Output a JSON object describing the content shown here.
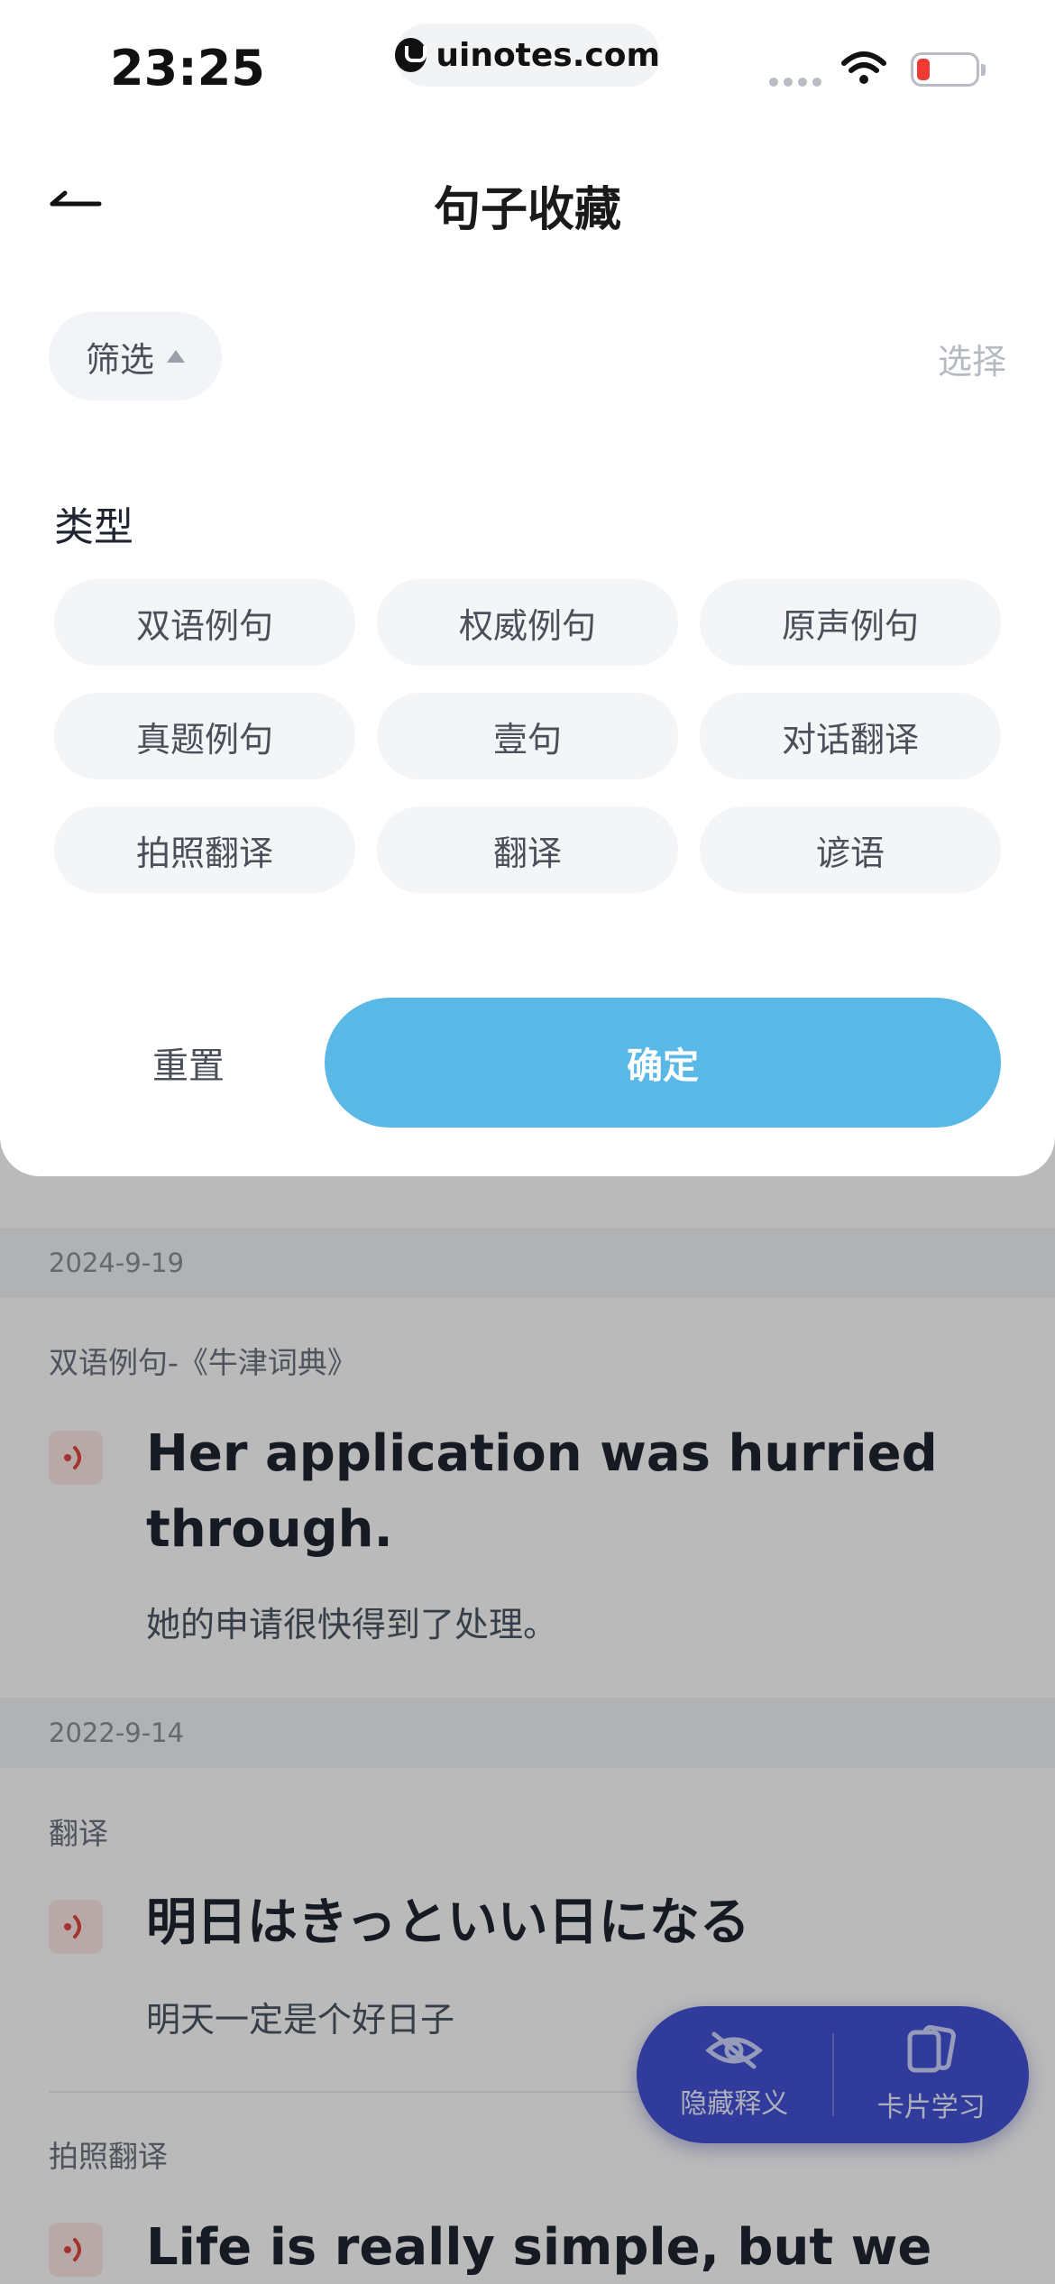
{
  "status_bar": {
    "time": "23:25",
    "url": "uinotes.com"
  },
  "header": {
    "title": "句子收藏"
  },
  "toolbar": {
    "filter_label": "筛选",
    "select_label": "选择"
  },
  "filter": {
    "type_label": "类型",
    "types": [
      "双语例句",
      "权威例句",
      "原声例句",
      "真题例句",
      "壹句",
      "对话翻译",
      "拍照翻译",
      "翻译",
      "谚语"
    ],
    "reset_label": "重置",
    "confirm_label": "确定"
  },
  "list": {
    "groups": [
      {
        "date": "2024-9-19",
        "entries": [
          {
            "source": "双语例句-《牛津词典》",
            "text": "Her application was hurried through.",
            "translation": "她的申请很快得到了处理。"
          }
        ]
      },
      {
        "date": "2022-9-14",
        "entries": [
          {
            "source": "翻译",
            "text": "明日はきっといい日になる",
            "translation": "明天一定是个好日子"
          },
          {
            "source": "拍照翻译",
            "text": "Life is really simple, but we",
            "translation": ""
          }
        ]
      }
    ]
  },
  "fab": {
    "hide_label": "隐藏释义",
    "card_label": "卡片学习"
  },
  "colors": {
    "accent": "#5ab8e6",
    "fab": "#4352d6",
    "speaker": "#e0483c"
  }
}
